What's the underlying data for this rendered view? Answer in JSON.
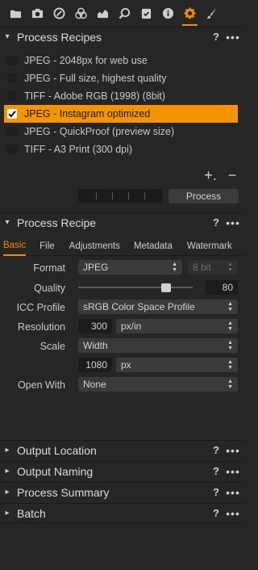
{
  "toolbar": {
    "icons": [
      "folder-icon",
      "camera-icon",
      "lens-icon",
      "color-icon",
      "exposure-icon",
      "loupe-icon",
      "metadata-icon",
      "info-icon",
      "gear-icon",
      "brush-icon"
    ],
    "active_icon": "gear-icon",
    "accent": "#f08a00"
  },
  "process_recipes": {
    "title": "Process Recipes",
    "help": "?",
    "more": "•••",
    "items": [
      {
        "label": "JPEG - 2048px for web use",
        "checked": false
      },
      {
        "label": "JPEG - Full size, highest quality",
        "checked": false
      },
      {
        "label": "TIFF - Adobe RGB (1998) (8bit)",
        "checked": false
      },
      {
        "label": "JPEG - Instagram optimized",
        "checked": true
      },
      {
        "label": "JPEG - QuickProof (preview size)",
        "checked": false
      },
      {
        "label": "TIFF - A3 Print (300 dpi)",
        "checked": false
      }
    ],
    "add": "+.",
    "remove": "−",
    "process_button": "Process"
  },
  "process_recipe": {
    "title": "Process Recipe",
    "help": "?",
    "more": "•••",
    "tabs": [
      "Basic",
      "File",
      "Adjustments",
      "Metadata",
      "Watermark"
    ],
    "active_tab": "Basic",
    "format_label": "Format",
    "format_value": "JPEG",
    "bit_value": "8 bit",
    "quality_label": "Quality",
    "quality_value": "80",
    "icc_label": "ICC Profile",
    "icc_value": "sRGB Color Space Profile",
    "resolution_label": "Resolution",
    "resolution_value": "300",
    "resolution_unit": "px/in",
    "scale_label": "Scale",
    "scale_value": "Width",
    "scale_size": "1080",
    "scale_unit": "px",
    "open_with_label": "Open With",
    "open_with_value": "None"
  },
  "collapsed_sections": [
    {
      "title": "Output Location",
      "help": "?",
      "more": "•••"
    },
    {
      "title": "Output Naming",
      "help": "?",
      "more": "•••"
    },
    {
      "title": "Process Summary",
      "help": "?",
      "more": "•••"
    },
    {
      "title": "Batch",
      "help": "?",
      "more": "•••"
    }
  ]
}
